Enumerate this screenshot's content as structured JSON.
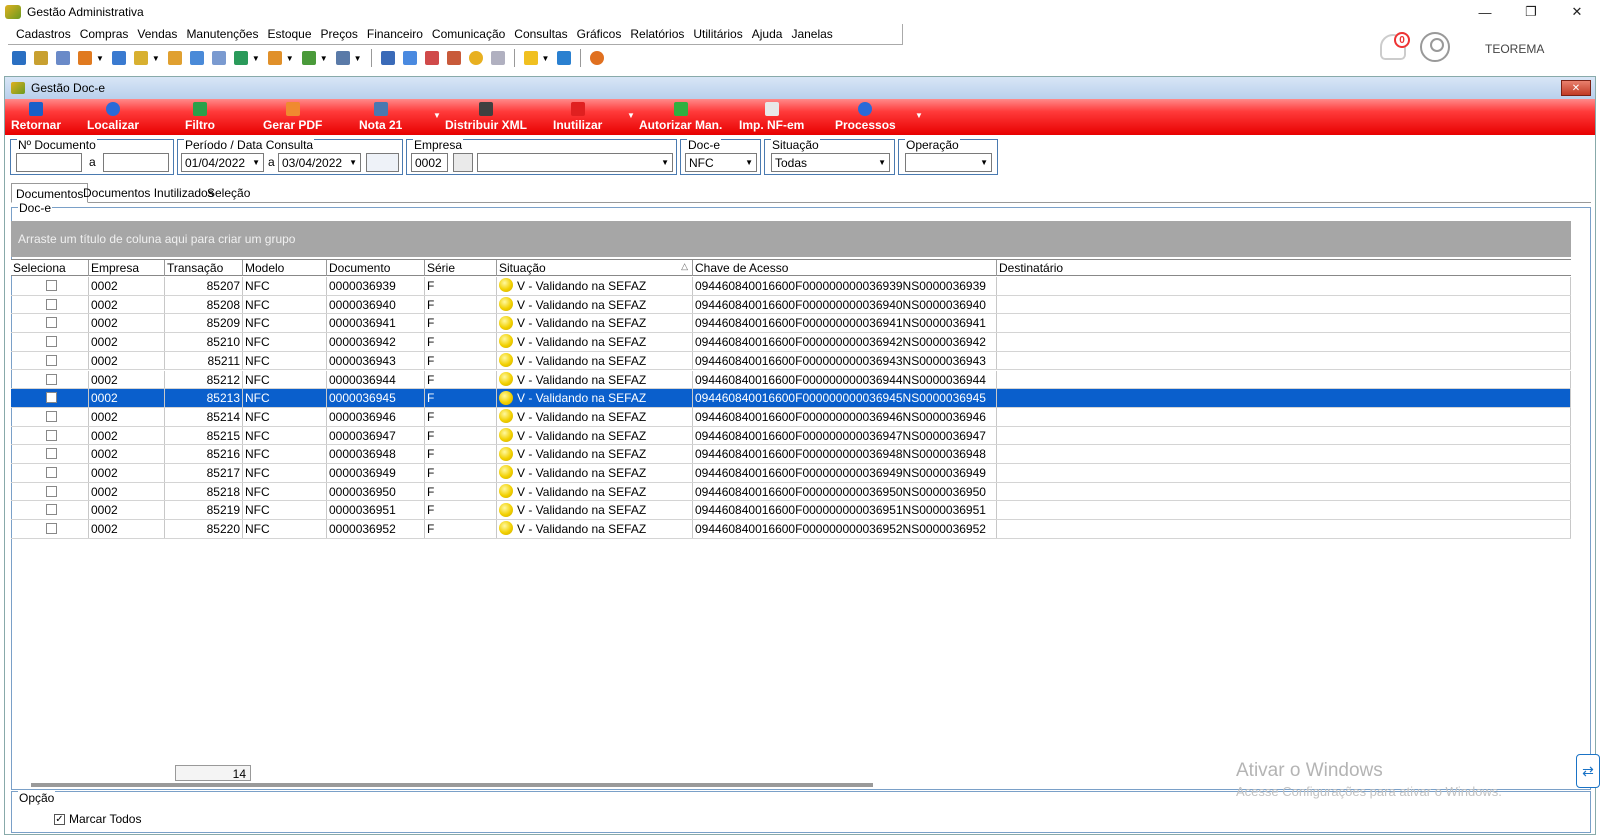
{
  "window": {
    "title": "Gestão Administrativa",
    "min": "—",
    "restore": "❐",
    "close": "✕"
  },
  "menu": [
    "Cadastros",
    "Compras",
    "Vendas",
    "Manutenções",
    "Estoque",
    "Preços",
    "Financeiro",
    "Comunicação",
    "Consultas",
    "Gráficos",
    "Relatórios",
    "Utilitários",
    "Ajuda",
    "Janelas"
  ],
  "header": {
    "notifications": "0",
    "company": "TEOREMA"
  },
  "inner": {
    "title": "Gestão Doc-e",
    "close": "✕"
  },
  "actions": [
    "Retornar",
    "Localizar",
    "Filtro",
    "Gerar PDF",
    "Nota 21",
    "Distribuir XML",
    "Inutilizar",
    "Autorizar Man.",
    "Imp. NF-em",
    "Processos"
  ],
  "filters": {
    "num_doc": {
      "label": "Nº Documento",
      "from": "",
      "sep": "a",
      "to": ""
    },
    "periodo": {
      "label": "Período / Data Consulta",
      "start": "01/04/2022",
      "sep": "a",
      "end": "03/04/2022"
    },
    "empresa": {
      "label": "Empresa",
      "code": "0002",
      "name": ""
    },
    "doce": {
      "label": "Doc-e",
      "value": "NFC"
    },
    "situacao": {
      "label": "Situação",
      "value": "Todas"
    },
    "operacao": {
      "label": "Operação",
      "value": ""
    }
  },
  "tabs": [
    "Documentos",
    "Documentos Inutilizados",
    "Seleção"
  ],
  "group_label": "Doc-e",
  "group_hint": "Arraste um título de coluna aqui para criar um grupo",
  "columns": [
    "Seleciona",
    "Empresa",
    "Transação",
    "Modelo",
    "Documento",
    "Série",
    "Situação",
    "Chave de Acesso",
    "Destinatário"
  ],
  "rows": [
    {
      "empresa": "0002",
      "transacao": "85207",
      "modelo": "NFC",
      "documento": "0000036939",
      "serie": "F",
      "situacao": "V - Validando na SEFAZ",
      "chave": "094460840016600F000000000036939NS0000036939",
      "destinatario": ""
    },
    {
      "empresa": "0002",
      "transacao": "85208",
      "modelo": "NFC",
      "documento": "0000036940",
      "serie": "F",
      "situacao": "V - Validando na SEFAZ",
      "chave": "094460840016600F000000000036940NS0000036940",
      "destinatario": ""
    },
    {
      "empresa": "0002",
      "transacao": "85209",
      "modelo": "NFC",
      "documento": "0000036941",
      "serie": "F",
      "situacao": "V - Validando na SEFAZ",
      "chave": "094460840016600F000000000036941NS0000036941",
      "destinatario": ""
    },
    {
      "empresa": "0002",
      "transacao": "85210",
      "modelo": "NFC",
      "documento": "0000036942",
      "serie": "F",
      "situacao": "V - Validando na SEFAZ",
      "chave": "094460840016600F000000000036942NS0000036942",
      "destinatario": ""
    },
    {
      "empresa": "0002",
      "transacao": "85211",
      "modelo": "NFC",
      "documento": "0000036943",
      "serie": "F",
      "situacao": "V - Validando na SEFAZ",
      "chave": "094460840016600F000000000036943NS0000036943",
      "destinatario": ""
    },
    {
      "empresa": "0002",
      "transacao": "85212",
      "modelo": "NFC",
      "documento": "0000036944",
      "serie": "F",
      "situacao": "V - Validando na SEFAZ",
      "chave": "094460840016600F000000000036944NS0000036944",
      "destinatario": ""
    },
    {
      "empresa": "0002",
      "transacao": "85213",
      "modelo": "NFC",
      "documento": "0000036945",
      "serie": "F",
      "situacao": "V - Validando na SEFAZ",
      "chave": "094460840016600F000000000036945NS0000036945",
      "destinatario": ""
    },
    {
      "empresa": "0002",
      "transacao": "85214",
      "modelo": "NFC",
      "documento": "0000036946",
      "serie": "F",
      "situacao": "V - Validando na SEFAZ",
      "chave": "094460840016600F000000000036946NS0000036946",
      "destinatario": ""
    },
    {
      "empresa": "0002",
      "transacao": "85215",
      "modelo": "NFC",
      "documento": "0000036947",
      "serie": "F",
      "situacao": "V - Validando na SEFAZ",
      "chave": "094460840016600F000000000036947NS0000036947",
      "destinatario": ""
    },
    {
      "empresa": "0002",
      "transacao": "85216",
      "modelo": "NFC",
      "documento": "0000036948",
      "serie": "F",
      "situacao": "V - Validando na SEFAZ",
      "chave": "094460840016600F000000000036948NS0000036948",
      "destinatario": ""
    },
    {
      "empresa": "0002",
      "transacao": "85217",
      "modelo": "NFC",
      "documento": "0000036949",
      "serie": "F",
      "situacao": "V - Validando na SEFAZ",
      "chave": "094460840016600F000000000036949NS0000036949",
      "destinatario": ""
    },
    {
      "empresa": "0002",
      "transacao": "85218",
      "modelo": "NFC",
      "documento": "0000036950",
      "serie": "F",
      "situacao": "V - Validando na SEFAZ",
      "chave": "094460840016600F000000000036950NS0000036950",
      "destinatario": ""
    },
    {
      "empresa": "0002",
      "transacao": "85219",
      "modelo": "NFC",
      "documento": "0000036951",
      "serie": "F",
      "situacao": "V - Validando na SEFAZ",
      "chave": "094460840016600F000000000036951NS0000036951",
      "destinatario": ""
    },
    {
      "empresa": "0002",
      "transacao": "85220",
      "modelo": "NFC",
      "documento": "0000036952",
      "serie": "F",
      "situacao": "V - Validando na SEFAZ",
      "chave": "094460840016600F000000000036952NS0000036952",
      "destinatario": ""
    }
  ],
  "selected_row": 6,
  "footer": {
    "count": "14"
  },
  "options": {
    "label": "Opção",
    "marcar_todos": "Marcar Todos",
    "checked": "✓"
  },
  "watermark": {
    "line1": "Ativar o Windows",
    "line2": "Acesse Configurações para ativar o Windows."
  },
  "colors": {
    "accent_red": "#e80000",
    "selection_blue": "#0a5fcc",
    "status_yellow": "#f2d000"
  }
}
